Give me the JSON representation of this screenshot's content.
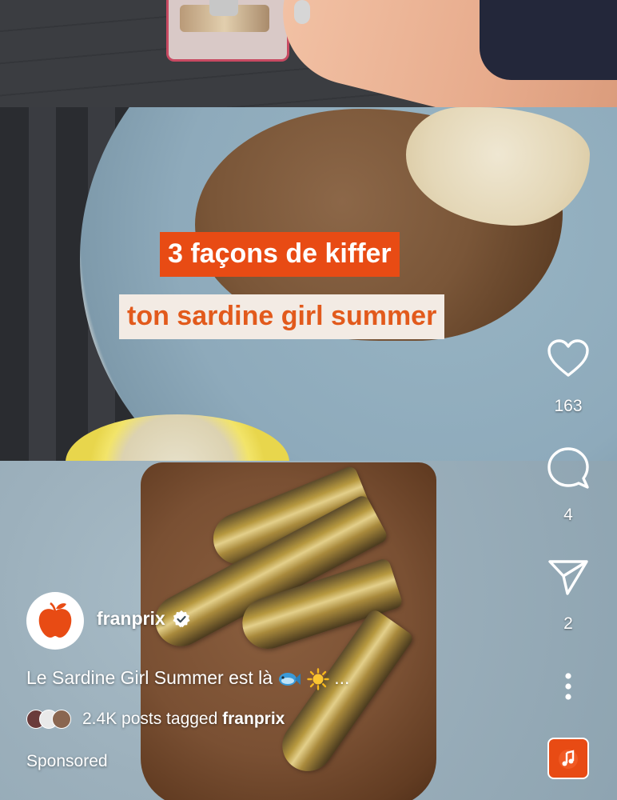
{
  "video": {
    "caption_line1": "3 façons de kiffer",
    "caption_line2": "ton sardine girl summer"
  },
  "actions": {
    "like_count": "163",
    "comment_count": "4",
    "share_count": "2"
  },
  "account": {
    "username": "franprix",
    "verified": true
  },
  "post": {
    "caption": "Le Sardine Girl Summer est là",
    "caption_emojis": [
      "fish-emoji",
      "sun-emoji"
    ],
    "caption_more": "...",
    "tagged_count_text": "2.4K posts tagged",
    "tagged_account": "franprix",
    "sponsored_label": "Sponsored"
  },
  "colors": {
    "brand_orange": "#e84b14",
    "caption_bg_light": "#f3ebe4",
    "caption_text_orange": "#e25a1c"
  }
}
